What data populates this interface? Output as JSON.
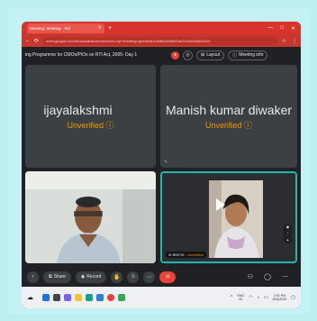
{
  "browser": {
    "tab_title": "Meeting: Meeting - Wir",
    "tab_close": "✕",
    "new_tab": "+",
    "window_controls": [
      "—",
      "□",
      "✕"
    ],
    "url": "meet.google.com/ddoessdtcdcdevmeeetve-mp/?meeting=gbexb0a1c8dfe0dc6b5f1ae2e01b9dbd5d1e3",
    "address_icons": [
      "☆",
      "⋮"
    ]
  },
  "meeting": {
    "title": "ing Programme for CMOs/PIOs on RTI Act, 2005- Day 1",
    "layout_label": "Layout",
    "info_label": "Meeting info"
  },
  "participants": [
    {
      "name": "ijayalakshmi",
      "status": "Unverified ⓘ"
    },
    {
      "name": "Manish kumar diwaker",
      "status": "Unverified ⓘ"
    }
  ],
  "self_tile": {
    "name": "REETA",
    "status": "Unverified"
  },
  "controls": {
    "share_label": "Share",
    "record_label": "Record",
    "hangup_icon": "✕"
  },
  "taskbar": {
    "lang": "ENG",
    "region": "IN",
    "time": "2:51 PM",
    "date": "8/18/2023"
  },
  "colors": {
    "brand_red": "#d9342b",
    "tile_bg": "#3c4043",
    "unverified": "#f29900",
    "active_border": "#22b8b0"
  }
}
